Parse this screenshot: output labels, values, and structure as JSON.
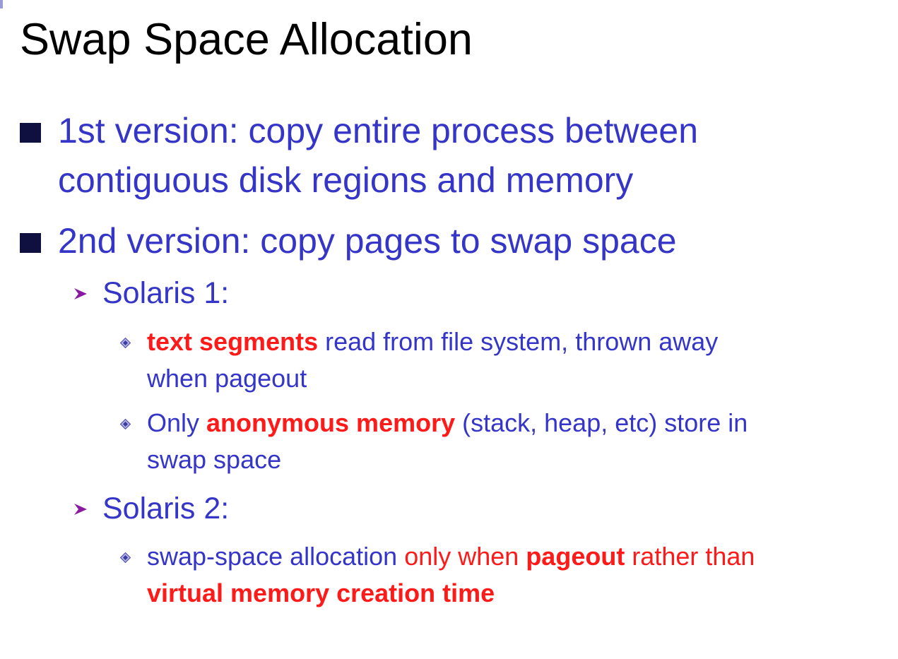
{
  "slide": {
    "title": "Swap Space Allocation",
    "bullets": [
      {
        "line1": "1st version: copy entire process between",
        "line2": "contiguous disk regions and memory"
      },
      {
        "line1": "2nd version: copy pages to swap space"
      }
    ],
    "solaris1": {
      "label": "Solaris 1:",
      "items": [
        {
          "emph": "text segments",
          "rest_line1": " read from file system, thrown away",
          "line2": "when pageout"
        },
        {
          "pre": "Only ",
          "emph": "anonymous memory",
          "rest_line1": " (stack, heap, etc) store in",
          "line2": "swap space"
        }
      ]
    },
    "solaris2": {
      "label": "Solaris 2:",
      "items": [
        {
          "pre": "swap-space allocation ",
          "red1": "only when ",
          "emph1": "pageout",
          "red2": " rather than",
          "emph2": "virtual memory creation time"
        }
      ]
    }
  },
  "colors": {
    "body_text": "#3535c8",
    "emphasis": "#ff1a1a",
    "title": "#000000",
    "level1_bullet": "#101040",
    "arrow_bullet": "#8a1aa0"
  },
  "icons": {
    "level1_bullet": "square-bullet-icon",
    "level2_bullet": "arrow-bullet-icon",
    "level3_bullet": "diamond-bullet-icon"
  }
}
